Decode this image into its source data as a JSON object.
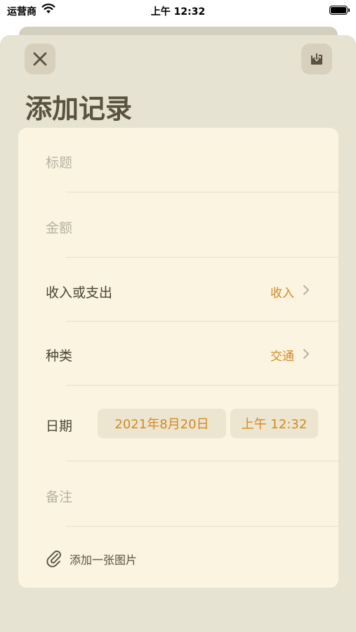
{
  "status_bar": {
    "carrier": "运营商",
    "time": "上午 12:32"
  },
  "header": {
    "title": "添加记录",
    "close_icon": "close-icon",
    "save_icon": "save-download-icon"
  },
  "form": {
    "title_placeholder": "标题",
    "amount_placeholder": "金额",
    "type_label": "收入或支出",
    "type_value": "收入",
    "category_label": "种类",
    "category_value": "交通",
    "date_label": "日期",
    "date_value": "2021年8月20日",
    "time_value": "上午 12:32",
    "note_placeholder": "备注",
    "attach_label": "添加一张图片"
  },
  "colors": {
    "accent": "#d28a25",
    "sheet_bg": "#e7e3d2",
    "card_bg": "#faf4e0",
    "button_bg": "#d6d0bc"
  }
}
